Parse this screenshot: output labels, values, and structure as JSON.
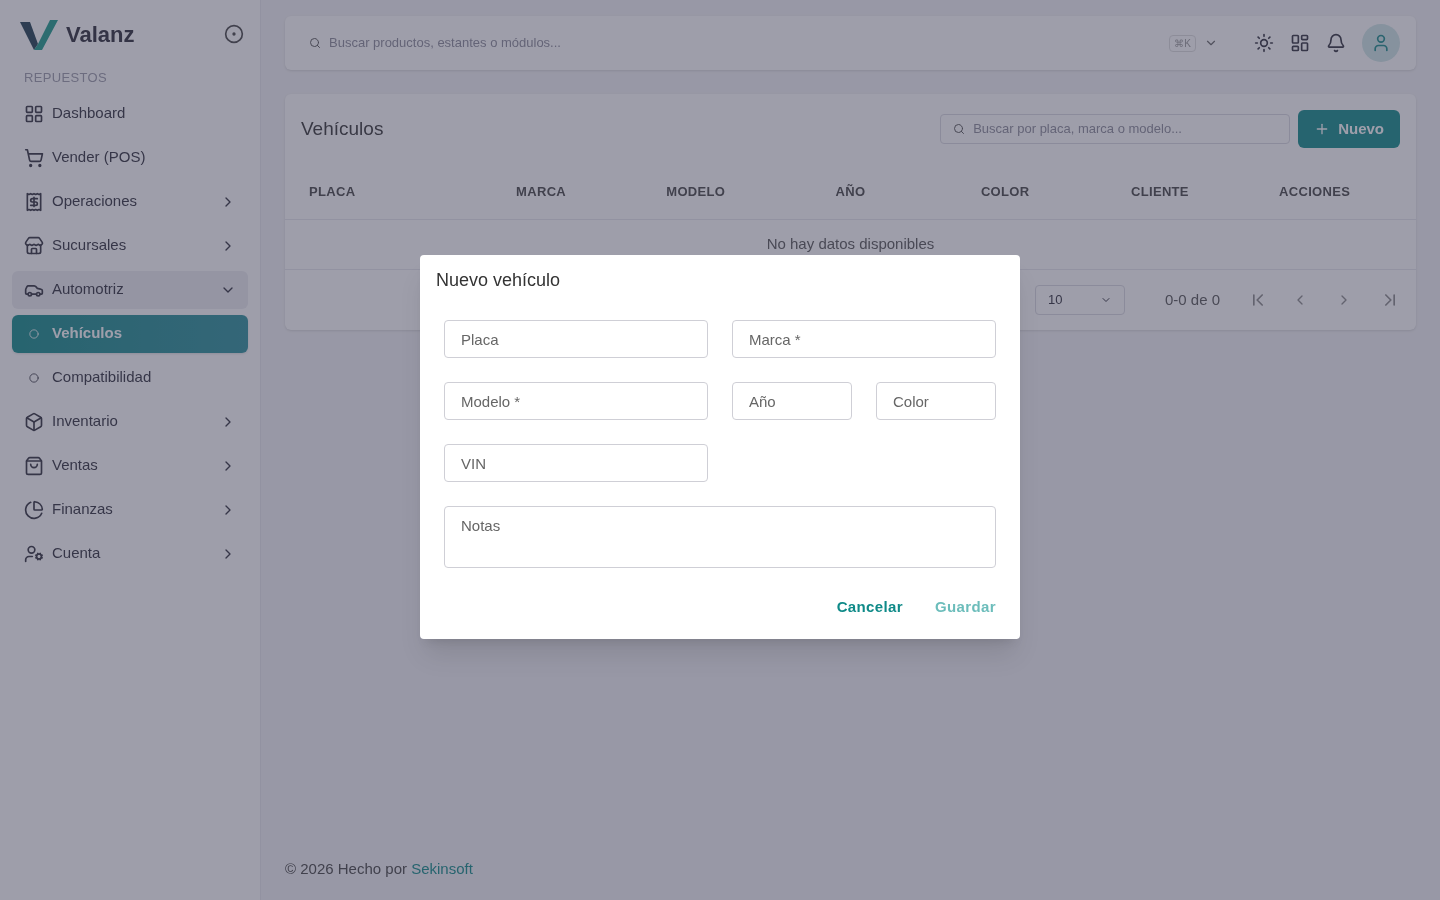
{
  "brand": {
    "name": "Valanz"
  },
  "sidebar": {
    "section": "REPUESTOS",
    "items": [
      {
        "label": "Dashboard",
        "kind": "item",
        "selected": false
      },
      {
        "label": "Vender (POS)",
        "kind": "item",
        "selected": false
      },
      {
        "label": "Operaciones",
        "kind": "group",
        "expanded": false,
        "selected": false
      },
      {
        "label": "Sucursales",
        "kind": "group",
        "expanded": false,
        "selected": false
      },
      {
        "label": "Automotriz",
        "kind": "group",
        "expanded": true,
        "selected": false
      },
      {
        "label": "Vehículos",
        "kind": "sub",
        "selected": true
      },
      {
        "label": "Compatibilidad",
        "kind": "sub",
        "selected": false
      },
      {
        "label": "Inventario",
        "kind": "group",
        "expanded": false,
        "selected": false
      },
      {
        "label": "Ventas",
        "kind": "group",
        "expanded": false,
        "selected": false
      },
      {
        "label": "Finanzas",
        "kind": "group",
        "expanded": false,
        "selected": false
      },
      {
        "label": "Cuenta",
        "kind": "group",
        "expanded": false,
        "selected": false
      }
    ]
  },
  "topbar": {
    "search_placeholder": "Buscar productos, estantes o módulos...",
    "shortcut": "⌘K"
  },
  "page": {
    "title": "Vehículos",
    "search_placeholder": "Buscar por placa, marca o modelo...",
    "new_button": "Nuevo",
    "columns": [
      "PLACA",
      "MARCA",
      "MODELO",
      "AÑO",
      "COLOR",
      "CLIENTE",
      "ACCIONES"
    ],
    "empty": "No hay datos disponibles",
    "page_size": "10",
    "range": "0-0 de 0"
  },
  "dialog": {
    "title": "Nuevo vehículo",
    "fields": [
      {
        "placeholder": "Placa",
        "kind": "half"
      },
      {
        "placeholder": "Marca *",
        "kind": "half"
      },
      {
        "placeholder": "Modelo *",
        "kind": "half"
      },
      {
        "placeholder": "Año",
        "kind": "quarter"
      },
      {
        "placeholder": "Color",
        "kind": "quarter"
      },
      {
        "placeholder": "VIN",
        "kind": "half"
      },
      {
        "placeholder": "Notas",
        "kind": "textarea"
      }
    ],
    "cancel": "Cancelar",
    "save": {
      "label": "Guardar",
      "disabled": true
    }
  },
  "footer": {
    "text": "© 2026 Hecho por",
    "link": "Sekinsoft"
  }
}
